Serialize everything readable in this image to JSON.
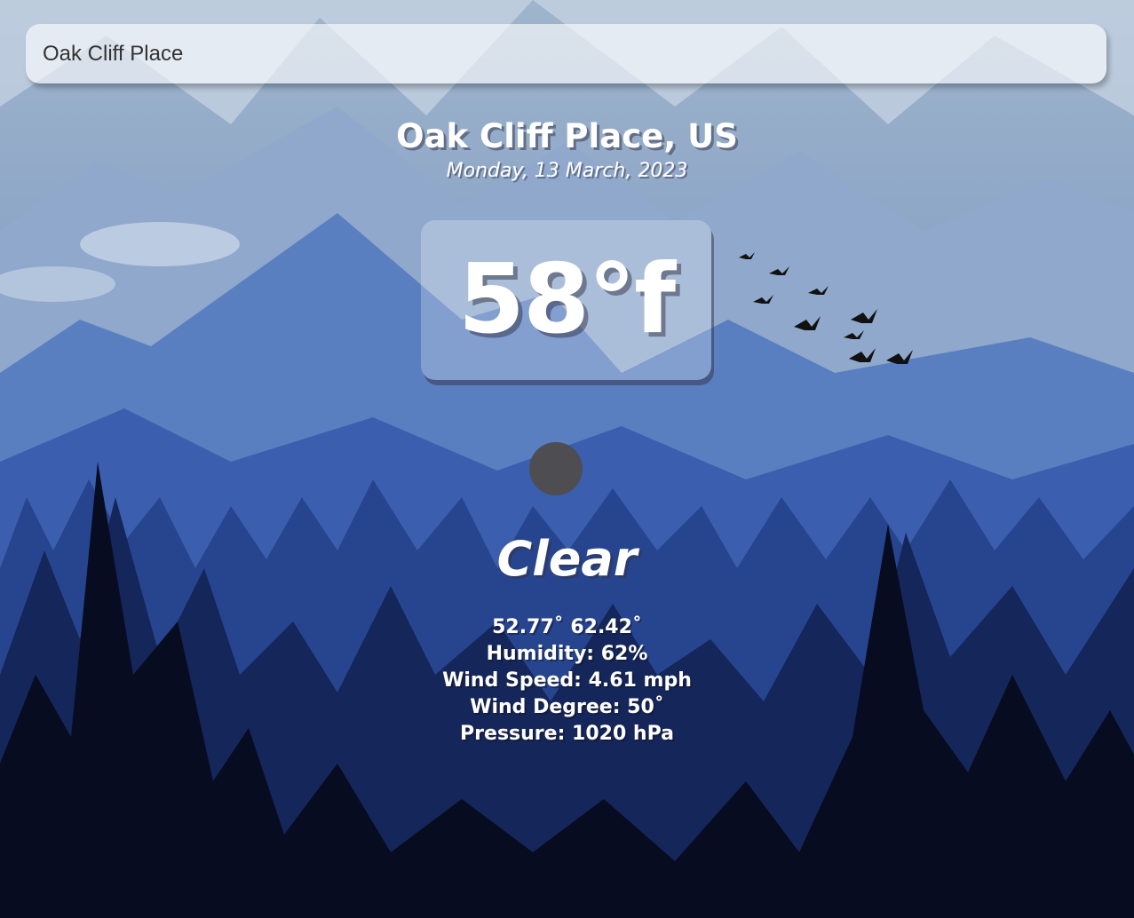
{
  "search": {
    "value": "Oak Cliff Place",
    "placeholder": ""
  },
  "location": {
    "title": "Oak Cliff Place, US",
    "date": "Monday, 13 March, 2023"
  },
  "weather": {
    "temperature": "58°f",
    "condition": "Clear",
    "icon": "weather-icon",
    "min_max": "52.77˚ 62.42˚",
    "humidity": "Humidity: 62%",
    "wind_speed": "Wind Speed: 4.61 mph",
    "wind_degree": "Wind Degree: 50˚",
    "pressure": "Pressure: 1020 hPa"
  },
  "colors": {
    "text": "#ffffff",
    "icon_placeholder": "#4d4d52",
    "search_text": "#333333"
  }
}
